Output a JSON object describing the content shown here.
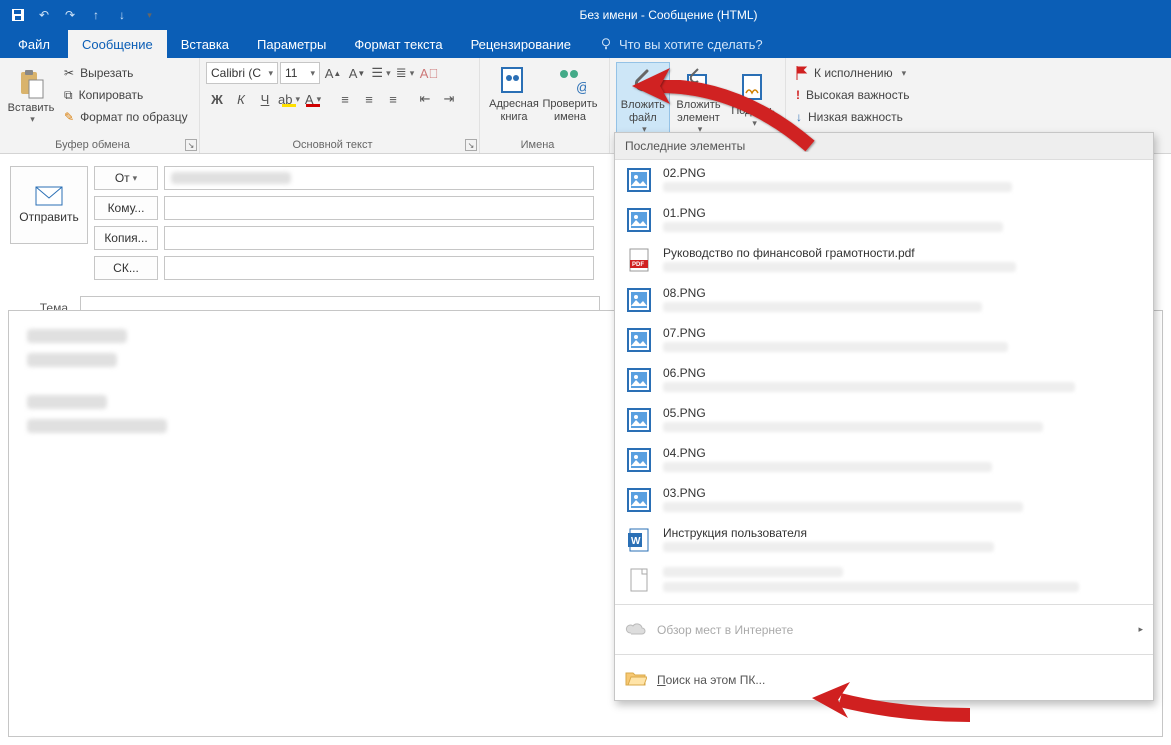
{
  "title": "Без имени - Сообщение (HTML)",
  "tabs": {
    "file": "Файл",
    "message": "Сообщение",
    "insert": "Вставка",
    "options": "Параметры",
    "format": "Формат текста",
    "review": "Рецензирование",
    "tellme": "Что вы хотите сделать?"
  },
  "ribbon": {
    "clipboard": {
      "paste": "Вставить",
      "cut": "Вырезать",
      "copy": "Копировать",
      "format_painter": "Формат по образцу",
      "group": "Буфер обмена"
    },
    "font": {
      "family": "Calibri (С",
      "size": "11",
      "group": "Основной текст"
    },
    "names": {
      "address_book": "Адресная книга",
      "check_names": "Проверить имена",
      "group": "Имена"
    },
    "include": {
      "attach_file": "Вложить файл",
      "attach_item": "Вложить элемент",
      "signature": "Подпись"
    },
    "tags": {
      "follow_up": "К исполнению",
      "high": "Высокая важность",
      "low": "Низкая важность"
    }
  },
  "compose": {
    "send": "Отправить",
    "from": "От",
    "to": "Кому...",
    "cc": "Копия...",
    "bcc": "СК...",
    "subject": "Тема"
  },
  "dropdown": {
    "header": "Последние элементы",
    "items": [
      {
        "name": "02.PNG",
        "type": "image"
      },
      {
        "name": "01.PNG",
        "type": "image"
      },
      {
        "name": "Руководство по финансовой грамотности.pdf",
        "type": "pdf"
      },
      {
        "name": "08.PNG",
        "type": "image"
      },
      {
        "name": "07.PNG",
        "type": "image"
      },
      {
        "name": "06.PNG",
        "type": "image"
      },
      {
        "name": "05.PNG",
        "type": "image"
      },
      {
        "name": "04.PNG",
        "type": "image"
      },
      {
        "name": "03.PNG",
        "type": "image"
      },
      {
        "name": "Инструкция пользователя",
        "type": "word"
      },
      {
        "name": "",
        "type": "file"
      }
    ],
    "browse_web": "Обзор мест в Интернете",
    "browse_pc": "Поиск на этом ПК..."
  }
}
